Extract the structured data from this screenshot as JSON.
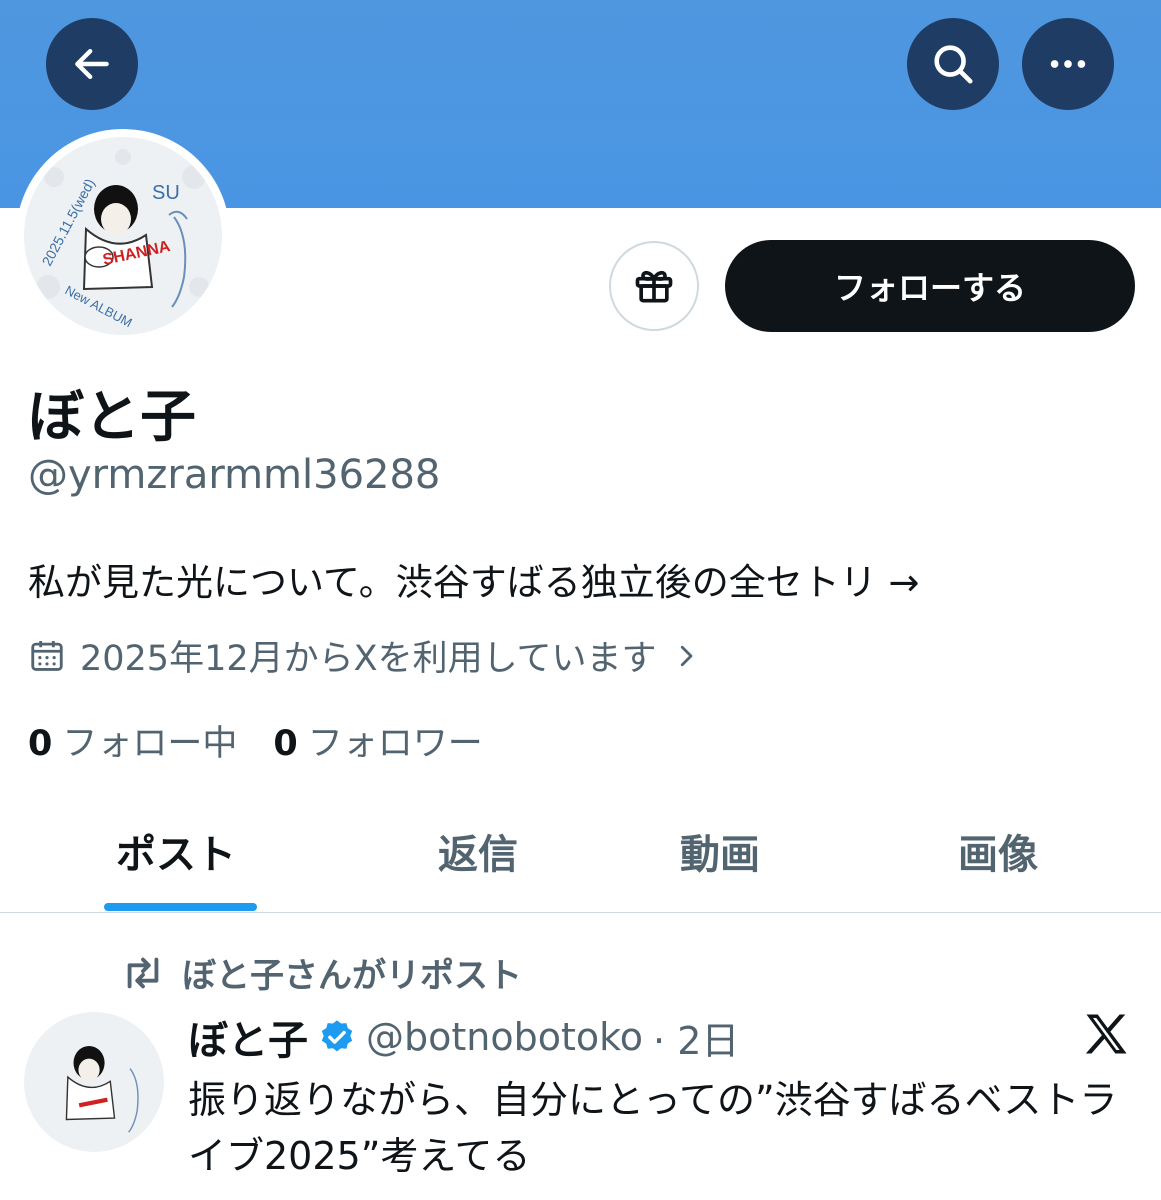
{
  "header": {
    "back_icon": "arrow-left-icon",
    "search_icon": "search-icon",
    "more_icon": "more-horizontal-icon",
    "banner_color": "#4a95e3"
  },
  "profile": {
    "display_name": "ぼと子",
    "handle": "@yrmzrarmml36288",
    "bio": "私が見た光について。渋谷すばる独立後の全セトリ →",
    "joined": "2025年12月からXを利用しています",
    "following_count": "0",
    "following_label": "フォロー中",
    "followers_count": "0",
    "followers_label": "フォロワー",
    "follow_button": "フォローする",
    "gift_icon": "gift-icon",
    "avatar_texts": [
      "2025.11.5(wed)",
      "SU",
      "SHANNA",
      "New ALBUM"
    ]
  },
  "tabs": [
    {
      "label": "ポスト",
      "active": true
    },
    {
      "label": "返信",
      "active": false
    },
    {
      "label": "動画",
      "active": false
    },
    {
      "label": "画像",
      "active": false
    }
  ],
  "post": {
    "repost_label": "ぼと子さんがリポスト",
    "author_name": "ぼと子",
    "author_handle": "@botnobotoko",
    "time": "· 2日",
    "text": "振り返りながら、自分にとっての”渋谷すばるベストライブ2025”考えてる",
    "verified_icon": "verified-badge-icon",
    "brand_icon": "x-logo-icon"
  },
  "colors": {
    "accent": "#1d9bf0",
    "text_primary": "#0f1419",
    "text_secondary": "#536471"
  }
}
